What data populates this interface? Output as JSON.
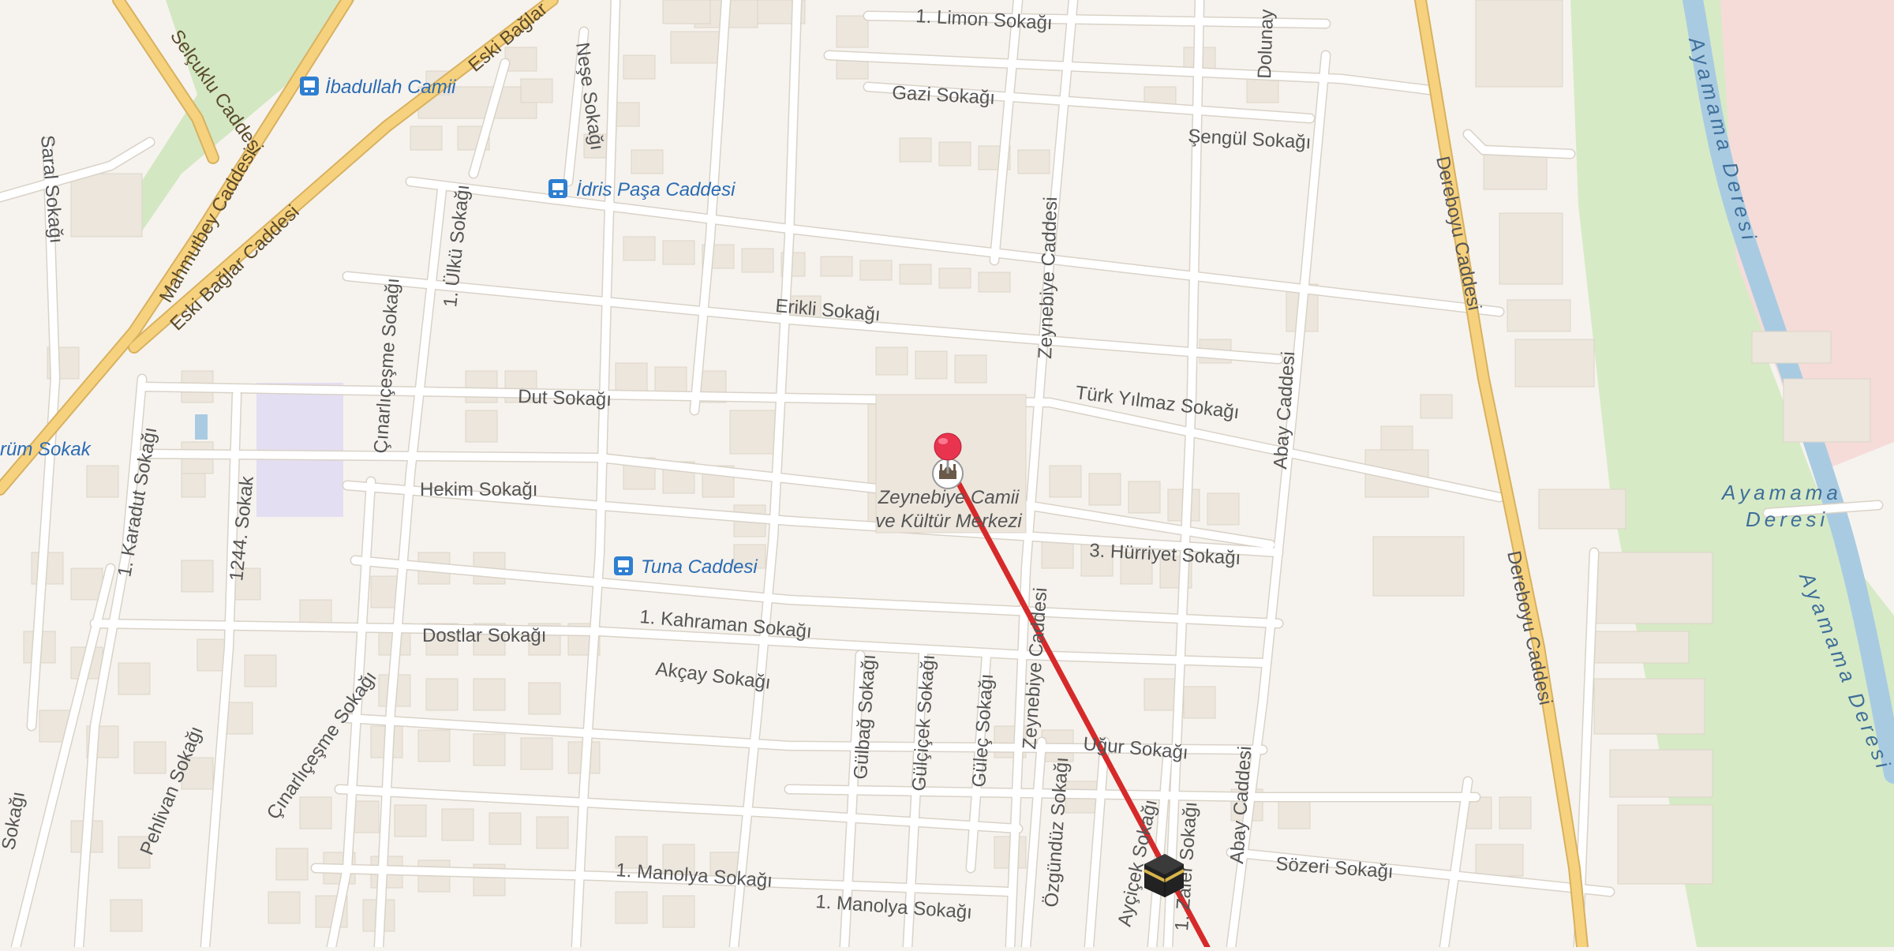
{
  "map": {
    "colors": {
      "background": "#f6f3ee",
      "street": "#ffffff",
      "street_casing": "#d9d2c7",
      "main_road": "#f7d27e",
      "main_road_casing": "#d8b160",
      "park": "#cfe6bd",
      "river": "#a9cbe2",
      "route_line": "#d62a2a",
      "pin": "#e8344e",
      "bus_stop": "#2f7fd1"
    },
    "streets": [
      "1. Limon Sokağı",
      "Gazi Sokağı",
      "Şengül Sokağı",
      "Dolunay",
      "İdris Paşa Caddesi",
      "Erikli Sokağı",
      "Zeynebiye Caddesi",
      "Dereboyu Caddesi",
      "Dereboyu Caddesi",
      "Türk Yılmaz Sokağı",
      "Abay Caddesi",
      "Dut Sokağı",
      "Hekim Sokağı",
      "3. Hürriyet Sokağı",
      "1. Kahraman Sokağı",
      "Dostlar Sokağı",
      "Akçay Sokağı",
      "Uğur Sokağı",
      "Sözeri Sokağı",
      "1. Manolya Sokağı",
      "1. Manolya Sokağı",
      "Gülbağ Sokağı",
      "Gülçiçek Sokağı",
      "Güleç Sokağı",
      "Zeynebiye Caddesi",
      "Özgündüz Sokağı",
      "Ayçiçek Sokağı",
      "1. Zafer Sokağı",
      "Abay Caddesi",
      "Selçuklu Caddesi",
      "Mahmutbey Caddesi",
      "Eski Bağlar Caddesi",
      "Eski Bağlar",
      "Neşe Sokağı",
      "1. Ülkü Sokağı",
      "Çınarlıçeşme Sokağı",
      "Çınarlıçeşme Sokağı",
      "Saral Sokağı",
      "1. Karadut Sokağı",
      "1244. Sokak",
      "Pehlivan Sokağı",
      "Sokağı",
      "rüm Sokak"
    ],
    "bus_stops": [
      "İbadullah Camii",
      "İdris Paşa Caddesi",
      "Tuna Caddesi"
    ],
    "poi": {
      "name_line1": "Zeynebiye Camii",
      "name_line2": "ve Kültür Merkezi",
      "icon": "mosque-icon"
    },
    "destination_icon": "kaaba-icon",
    "pin_icon": "map-pin-icon",
    "bus_icon": "bus-stop-icon",
    "water": {
      "river_name": "Ayamama Deresi",
      "area_line1": "Ayamama",
      "area_line2": "Deresi"
    }
  }
}
